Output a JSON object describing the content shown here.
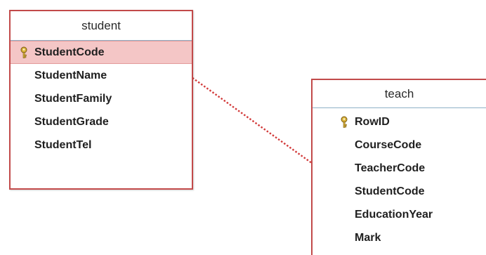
{
  "tables": [
    {
      "id": "student",
      "title": "student",
      "fields": [
        {
          "name": "StudentCode",
          "primary_key": true,
          "selected": true
        },
        {
          "name": "StudentName",
          "primary_key": false,
          "selected": false
        },
        {
          "name": "StudentFamily",
          "primary_key": false,
          "selected": false
        },
        {
          "name": "StudentGrade",
          "primary_key": false,
          "selected": false
        },
        {
          "name": "StudentTel",
          "primary_key": false,
          "selected": false
        }
      ]
    },
    {
      "id": "teach",
      "title": "teach",
      "fields": [
        {
          "name": "RowID",
          "primary_key": true,
          "selected": false
        },
        {
          "name": "CourseCode",
          "primary_key": false,
          "selected": false
        },
        {
          "name": "TeacherCode",
          "primary_key": false,
          "selected": false
        },
        {
          "name": "StudentCode",
          "primary_key": false,
          "selected": false
        },
        {
          "name": "EducationYear",
          "primary_key": false,
          "selected": false
        },
        {
          "name": "Mark",
          "primary_key": false,
          "selected": false
        }
      ]
    }
  ],
  "relationship": {
    "from": "student.StudentCode",
    "to": "teach.StudentCode",
    "line_color": "#d23a3a"
  },
  "colors": {
    "table_border": "#c24a4a",
    "header_divider": "#8fb0c6",
    "selected_row": "#f4c6c6",
    "key_icon": "#d9b23a"
  },
  "icons": {
    "primary_key": "key-icon"
  }
}
